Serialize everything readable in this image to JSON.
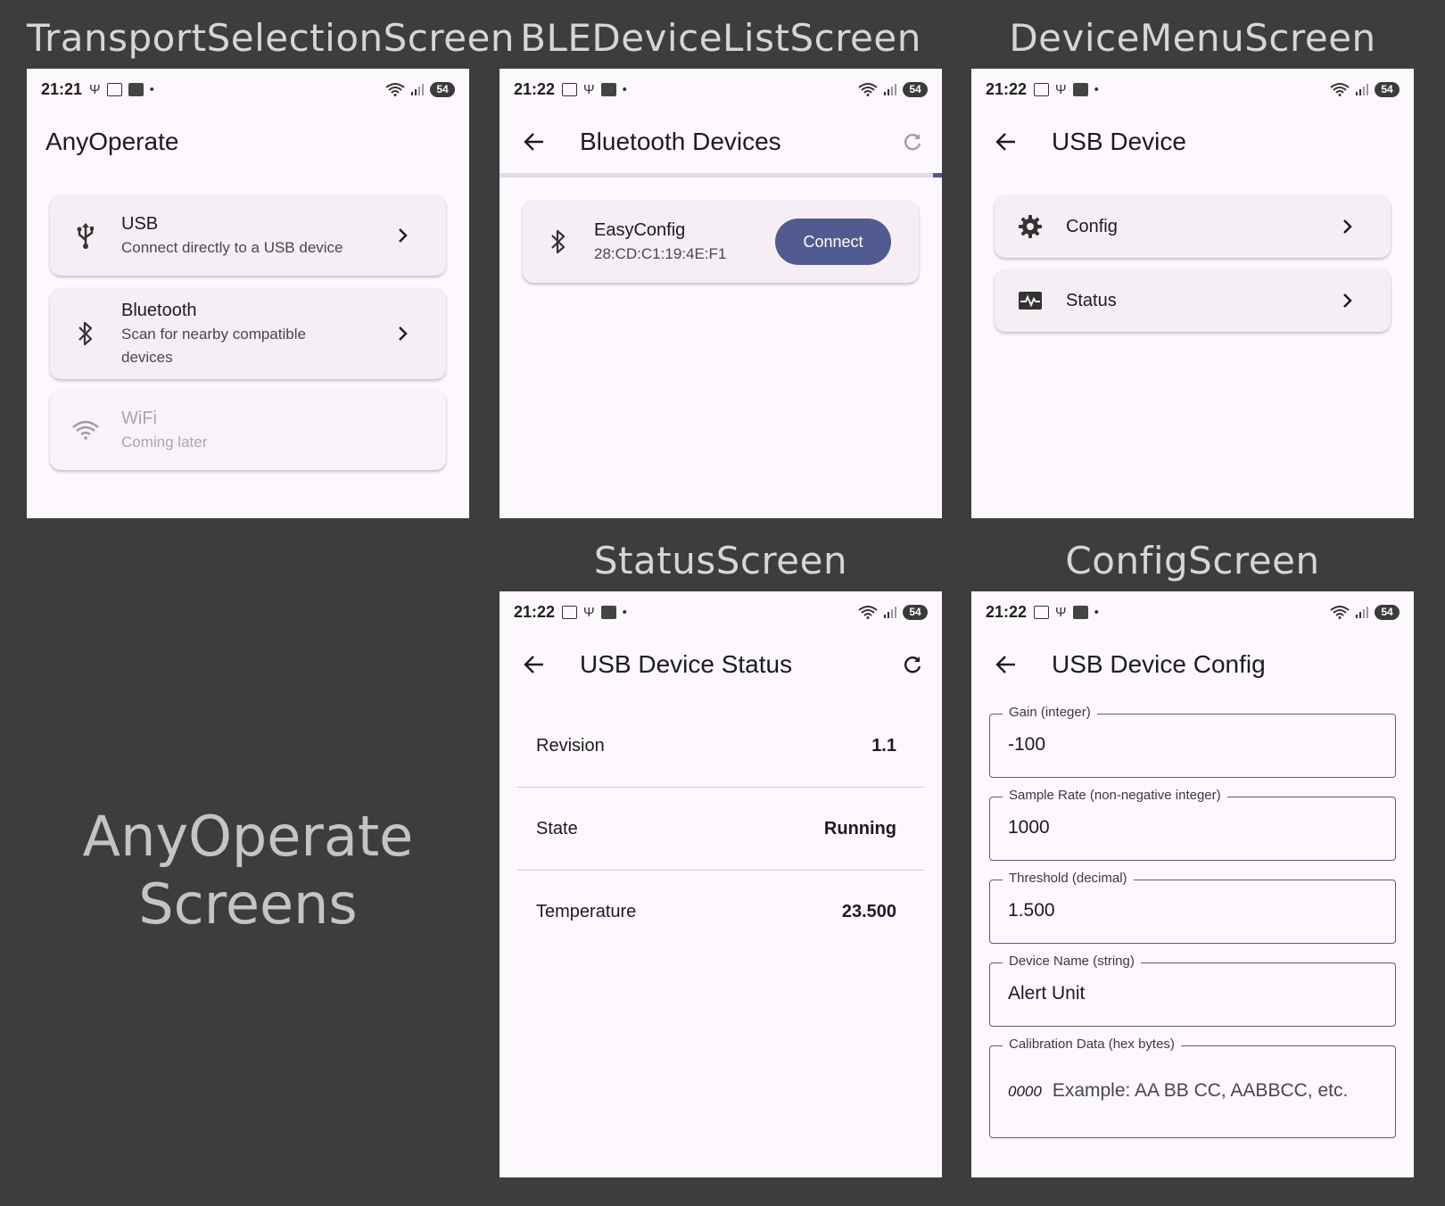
{
  "headings": {
    "transport": "TransportSelectionScreen",
    "ble": "BLEDeviceListScreen",
    "menu": "DeviceMenuScreen",
    "status": "StatusScreen",
    "config": "ConfigScreen",
    "big_line1": "AnyOperate",
    "big_line2": "Screens"
  },
  "statusbar": {
    "transport_time": "21:21",
    "time": "21:22",
    "battery": "54"
  },
  "transport": {
    "app_title": "AnyOperate",
    "options": [
      {
        "title": "USB",
        "subtitle": "Connect directly to a USB device",
        "icon": "usb-icon",
        "enabled": true
      },
      {
        "title": "Bluetooth",
        "subtitle": "Scan for nearby compatible devices",
        "icon": "bluetooth-icon",
        "enabled": true
      },
      {
        "title": "WiFi",
        "subtitle": "Coming later",
        "icon": "wifi-icon",
        "enabled": false
      }
    ]
  },
  "ble": {
    "title": "Bluetooth Devices",
    "device_name": "EasyConfig",
    "device_address": "28:CD:C1:19:4E:F1",
    "connect_label": "Connect"
  },
  "menu": {
    "title": "USB Device",
    "items": [
      {
        "label": "Config",
        "icon": "gear-icon"
      },
      {
        "label": "Status",
        "icon": "monitor-heart-icon"
      }
    ]
  },
  "status": {
    "title": "USB Device Status",
    "rows": [
      {
        "key": "Revision",
        "value": "1.1"
      },
      {
        "key": "State",
        "value": "Running"
      },
      {
        "key": "Temperature",
        "value": "23.500"
      }
    ]
  },
  "config": {
    "title": "USB Device Config",
    "fields": [
      {
        "label": "Gain (integer)",
        "value": "-100"
      },
      {
        "label": "Sample Rate (non-negative integer)",
        "value": "1000"
      },
      {
        "label": "Threshold (decimal)",
        "value": "1.500"
      },
      {
        "label": "Device Name (string)",
        "value": "Alert Unit"
      },
      {
        "label": "Calibration Data (hex bytes)",
        "prefix": "0000",
        "placeholder": "Example: AA BB CC, AABBCC, etc."
      }
    ]
  },
  "colors": {
    "background": "#3d3d3d",
    "screen": "#fdf8fd",
    "accent": "#525a92",
    "card": "#f5eff5"
  }
}
